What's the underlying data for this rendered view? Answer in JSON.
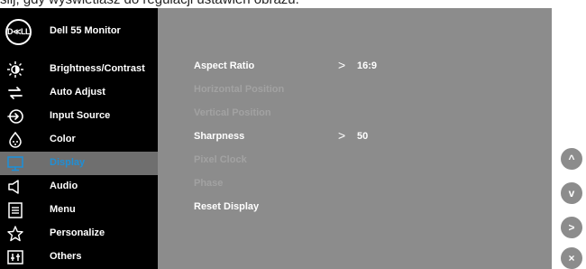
{
  "top_caption": "ślij, gdy wyświetlasz do regulacji ustawień obrazu.",
  "header": {
    "logo_text": "D≪LL",
    "monitor_title": "Dell 55 Monitor"
  },
  "sidebar": {
    "items": [
      {
        "label": "Brightness/Contrast",
        "icon": "brightness-icon"
      },
      {
        "label": "Auto Adjust",
        "icon": "auto-adjust-icon"
      },
      {
        "label": "Input Source",
        "icon": "input-source-icon"
      },
      {
        "label": "Color",
        "icon": "color-icon"
      },
      {
        "label": "Display",
        "icon": "display-icon",
        "active": true
      },
      {
        "label": "Audio",
        "icon": "audio-icon"
      },
      {
        "label": "Menu",
        "icon": "menu-icon"
      },
      {
        "label": "Personalize",
        "icon": "star-icon"
      },
      {
        "label": "Others",
        "icon": "others-icon"
      }
    ]
  },
  "submenu": {
    "items": [
      {
        "label": "Aspect Ratio",
        "value": "16:9",
        "arrow": ">",
        "enabled": true
      },
      {
        "label": "Horizontal Position",
        "enabled": false
      },
      {
        "label": "Vertical Position",
        "enabled": false
      },
      {
        "label": "Sharpness",
        "value": "50",
        "arrow": ">",
        "enabled": true
      },
      {
        "label": "Pixel Clock",
        "enabled": false
      },
      {
        "label": "Phase",
        "enabled": false
      },
      {
        "label": "Reset Display",
        "enabled": true
      }
    ]
  },
  "nav_buttons": {
    "up": "^",
    "down": "v",
    "right": ">",
    "close": "×"
  },
  "colors": {
    "sidebar_bg": "#000000",
    "panel_bg": "#8c8c8c",
    "active_bg": "#6f6f6f",
    "active_text": "#1f8fd6",
    "disabled_text": "#a2a2a2"
  }
}
